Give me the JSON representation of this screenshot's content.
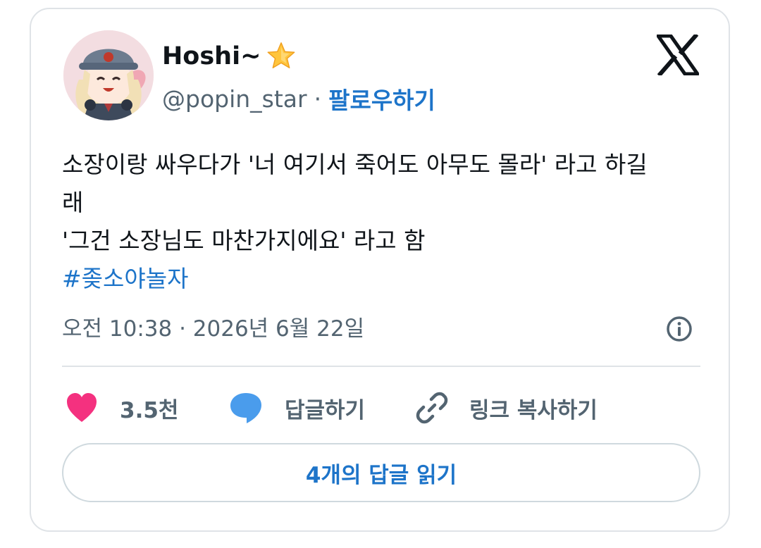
{
  "author": {
    "display_name": "Hoshi~",
    "handle": "@popin_star",
    "separator": "·",
    "follow_label": "팔로우하기"
  },
  "tweet": {
    "line1": "소장이랑 싸우다가 '너 여기서 죽어도 아무도 몰라' 라고 하길",
    "line2": "래",
    "line3": "'그건 소장님도 마찬가지에요' 라고 함",
    "hashtag": "#좆소야놀자",
    "timestamp": "오전 10:38 · 2026년 6월 22일"
  },
  "actions": {
    "like_count": "3.5천",
    "reply_label": "답글하기",
    "copy_link_label": "링크 복사하기",
    "read_replies_label": "4개의 답글 읽기"
  },
  "colors": {
    "accent": "#1d74c9",
    "like": "#f4317f",
    "reply": "#4a9cec",
    "muted": "#536471",
    "text": "#0f1419",
    "border": "#dfe3e7"
  },
  "icons": {
    "brand": "x-logo-icon",
    "badge": "star-icon",
    "like": "heart-icon",
    "reply": "speech-bubble-icon",
    "copy": "link-icon",
    "info": "info-icon"
  }
}
